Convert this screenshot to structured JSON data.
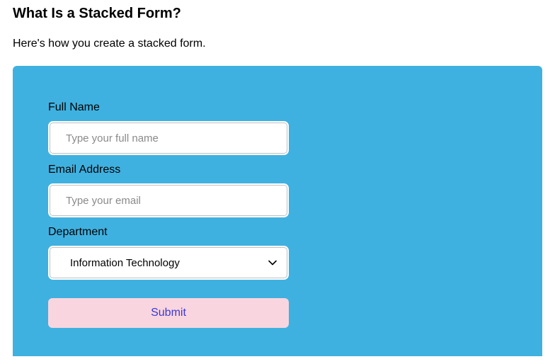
{
  "heading": "What Is a Stacked Form?",
  "intro": "Here's how you create a stacked form.",
  "form": {
    "fullName": {
      "label": "Full Name",
      "placeholder": "Type your full name",
      "value": ""
    },
    "email": {
      "label": "Email Address",
      "placeholder": "Type your email",
      "value": ""
    },
    "department": {
      "label": "Department",
      "selected": "Information Technology"
    },
    "submitLabel": "Submit"
  }
}
